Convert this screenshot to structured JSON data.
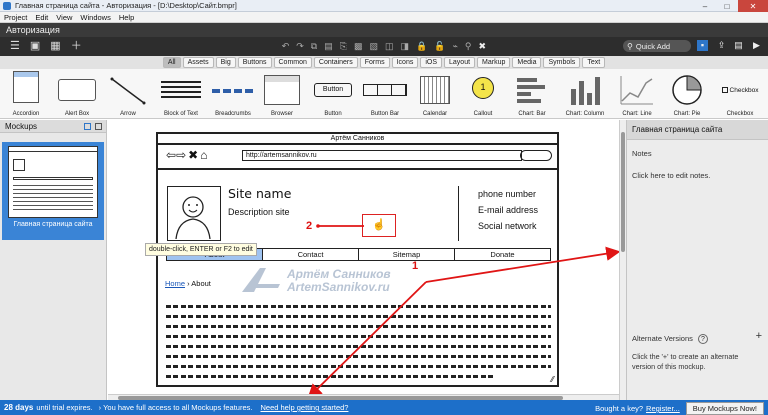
{
  "window": {
    "title": "Главная страница сайта - Авторизация - [D:\\Desktop\\Сайт.bmpr]",
    "minimize": "–",
    "maximize": "□",
    "close": "✕"
  },
  "menu": [
    "Project",
    "Edit",
    "View",
    "Windows",
    "Help"
  ],
  "doc_title": "Авторизация",
  "toolbar": {
    "quick_add": "Quick Add"
  },
  "filters": [
    "All",
    "Assets",
    "Big",
    "Buttons",
    "Common",
    "Containers",
    "Forms",
    "Icons",
    "iOS",
    "Layout",
    "Markup",
    "Media",
    "Symbols",
    "Text"
  ],
  "library": {
    "items": [
      "Accordion",
      "Alert Box",
      "Arrow",
      "Block of Text",
      "Breadcrumbs",
      "Browser",
      "Button",
      "Button Bar",
      "Calendar",
      "Callout",
      "Chart: Bar",
      "Chart: Column",
      "Chart: Line",
      "Chart: Pie",
      "Checkbox"
    ],
    "button_sample": "Button",
    "checkbox_sample": "Checkbox",
    "callout_sample": "1"
  },
  "left_panel": {
    "title": "Mockups",
    "thumb_label": "Главная страница сайта"
  },
  "mockup": {
    "title": "Артём Санников",
    "url": "http://artemsannikov.ru",
    "site_name": "Site name",
    "description": "Description site",
    "contact": [
      "phone number",
      "E-mail address",
      "Social network"
    ],
    "tabs": [
      "About",
      "Contact",
      "Sitemap",
      "Donate"
    ],
    "breadcrumb_home": "Home",
    "breadcrumb_sep": "›",
    "breadcrumb_current": "About"
  },
  "tooltip": "double-click, ENTER or F2 to edit",
  "watermark": {
    "line1": "Артём Санников",
    "line2": "ArtemSannikov.ru"
  },
  "annotations": {
    "n1": "1",
    "n2": "2"
  },
  "right_panel": {
    "title": "Главная страница сайта",
    "notes_label": "Notes",
    "notes_hint": "Click here to edit notes.",
    "alt_title": "Alternate Versions",
    "alt_help": "?",
    "alt_add": "+",
    "alt_text": "Click the '+' to create an alternate version of this mockup."
  },
  "status": {
    "days": "28 days",
    "expire_text": "until trial expires.",
    "access_text": "› You have full access to all Mockups features.",
    "help_link": "Need help getting started?",
    "bought": "Bought a key?",
    "register": "Register...",
    "buy": "Buy Mockups Now!"
  }
}
